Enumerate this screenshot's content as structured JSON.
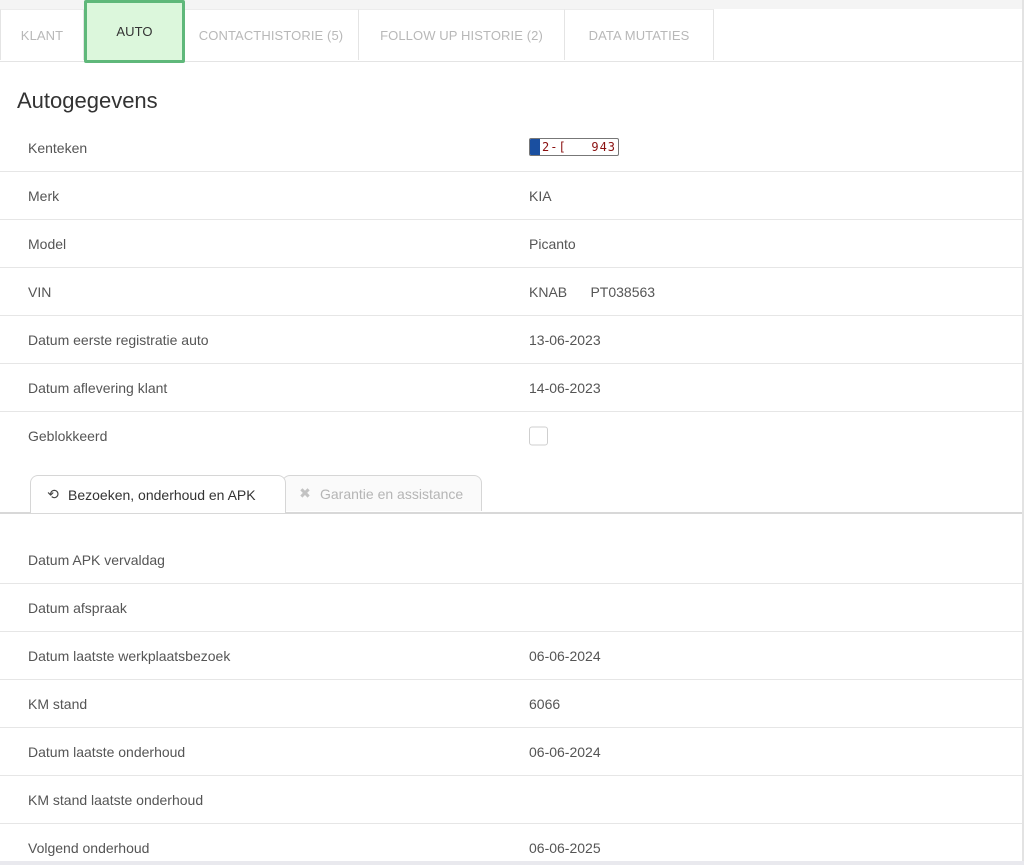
{
  "main_tabs": [
    {
      "label": "KLANT",
      "active": false
    },
    {
      "label": "AUTO",
      "active": true
    },
    {
      "label": "CONTACTHISTORIE (5)",
      "active": false
    },
    {
      "label": "FOLLOW UP HISTORIE (2)",
      "active": false
    },
    {
      "label": "DATA MUTATIES",
      "active": false
    }
  ],
  "section_title": "Autogegevens",
  "car_fields": {
    "kenteken": {
      "label": "Kenteken",
      "value": "2-[   943"
    },
    "merk": {
      "label": "Merk",
      "value": "KIA"
    },
    "model": {
      "label": "Model",
      "value": "Picanto"
    },
    "vin": {
      "label": "VIN",
      "value": "KNAB      PT038563"
    },
    "eerste_registratie": {
      "label": "Datum eerste registratie auto",
      "value": "13-06-2023"
    },
    "aflevering": {
      "label": "Datum aflevering klant",
      "value": "14-06-2023"
    },
    "geblokkeerd": {
      "label": "Geblokkeerd",
      "checked": false
    }
  },
  "sub_tabs": [
    {
      "label": "Bezoeken, onderhoud en APK",
      "icon": "history-icon",
      "active": true
    },
    {
      "label": "Garantie en assistance",
      "icon": "tools-icon",
      "active": false
    }
  ],
  "service_fields": {
    "apk_vervaldag": {
      "label": "Datum APK vervaldag",
      "value": ""
    },
    "afspraak": {
      "label": "Datum afspraak",
      "value": ""
    },
    "laatste_werkplaatsbezoek": {
      "label": "Datum laatste werkplaatsbezoek",
      "value": "06-06-2024"
    },
    "km_stand": {
      "label": "KM stand",
      "value": "6066"
    },
    "laatste_onderhoud": {
      "label": "Datum laatste onderhoud",
      "value": "06-06-2024"
    },
    "km_stand_laatste_onderhoud": {
      "label": "KM stand laatste onderhoud",
      "value": ""
    },
    "volgend_onderhoud": {
      "label": "Volgend onderhoud",
      "value": "06-06-2025"
    }
  },
  "colors": {
    "active_tab_bg": "#dcf7dc",
    "active_tab_border": "#5fb87a",
    "plate_text": "#8a1010",
    "plate_eu_band": "#1a4fa0"
  }
}
